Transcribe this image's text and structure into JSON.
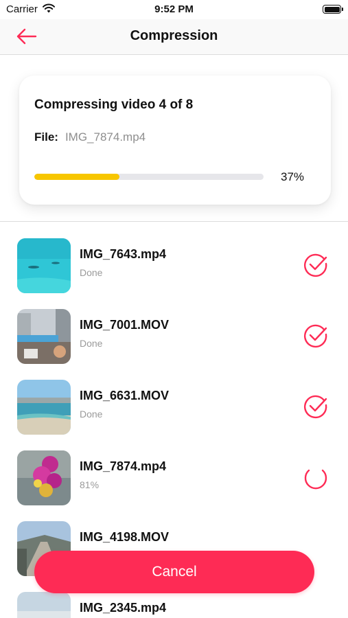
{
  "status_bar": {
    "carrier": "Carrier",
    "time": "9:52 PM"
  },
  "nav": {
    "title": "Compression"
  },
  "progress": {
    "heading": "Compressing video 4 of 8",
    "file_label": "File:",
    "file_name": "IMG_7874.mp4",
    "percent_text": "37%",
    "fraction": 0.37
  },
  "files": [
    {
      "name": "IMG_7643.mp4",
      "status": "Done",
      "state": "done",
      "icon": "check-circle-icon"
    },
    {
      "name": "IMG_7001.MOV",
      "status": "Done",
      "state": "done",
      "icon": "check-circle-icon"
    },
    {
      "name": "IMG_6631.MOV",
      "status": "Done",
      "state": "done",
      "icon": "check-circle-icon"
    },
    {
      "name": "IMG_7874.mp4",
      "status": "81%",
      "state": "in-progress",
      "icon": "spinner-icon"
    },
    {
      "name": "IMG_4198.MOV",
      "status": "",
      "state": "pending",
      "icon": ""
    },
    {
      "name": "IMG_2345.mp4",
      "status": "",
      "state": "pending",
      "icon": ""
    }
  ],
  "cancel_label": "Cancel",
  "colors": {
    "accent": "#fe2b55",
    "progress": "#f7c600",
    "track": "#e6e6ea"
  }
}
